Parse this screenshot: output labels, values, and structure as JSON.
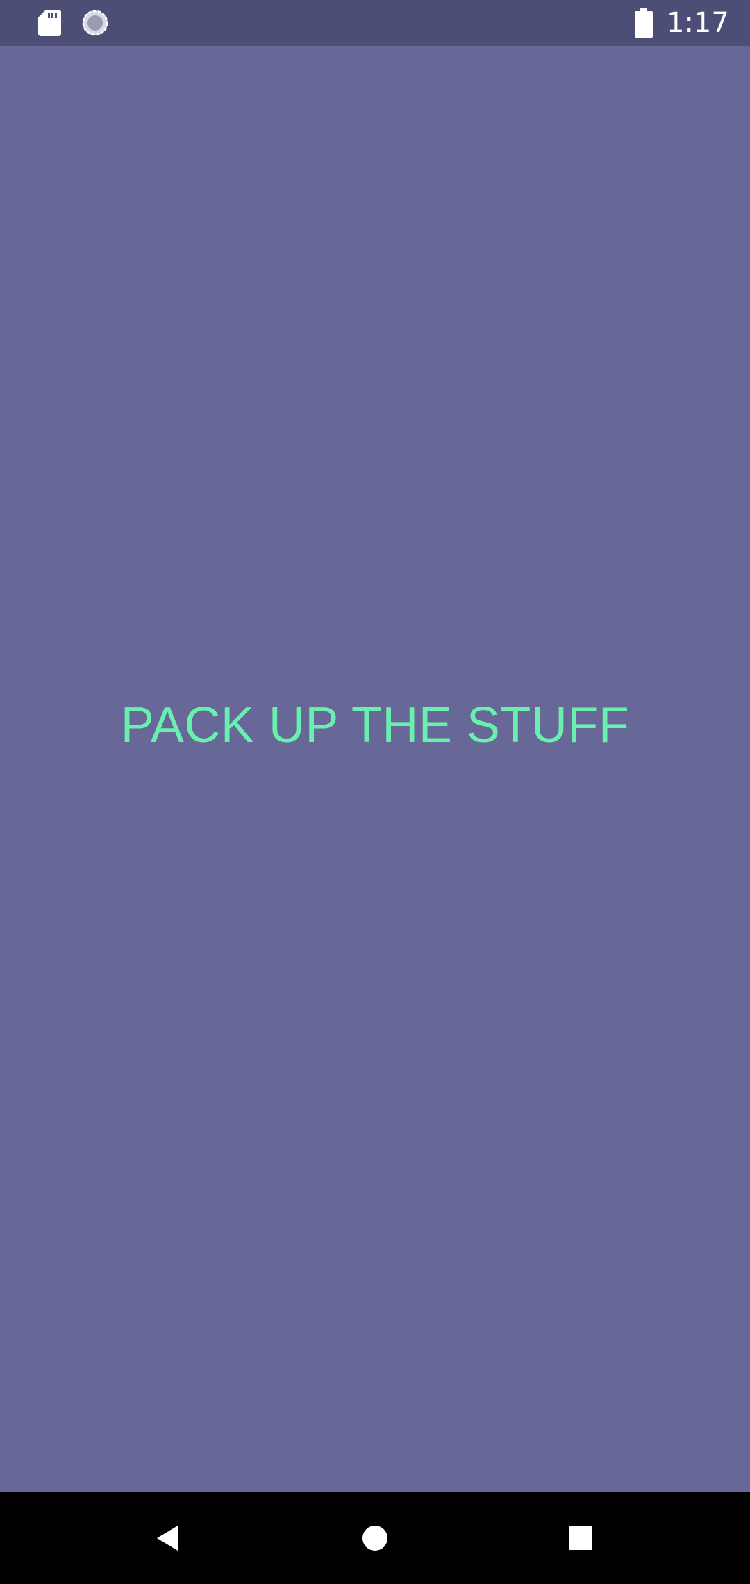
{
  "status_bar": {
    "time": "1:17",
    "icons": [
      "sd-card-icon",
      "loading-spinner-icon",
      "battery-icon"
    ],
    "background": "#4d4e75"
  },
  "main": {
    "message": "PACK UP THE STUFF",
    "background": "#676897",
    "text_color": "#69f0ae"
  },
  "nav_bar": {
    "buttons": [
      "back-icon",
      "home-icon",
      "recents-icon"
    ],
    "background": "#000000"
  }
}
